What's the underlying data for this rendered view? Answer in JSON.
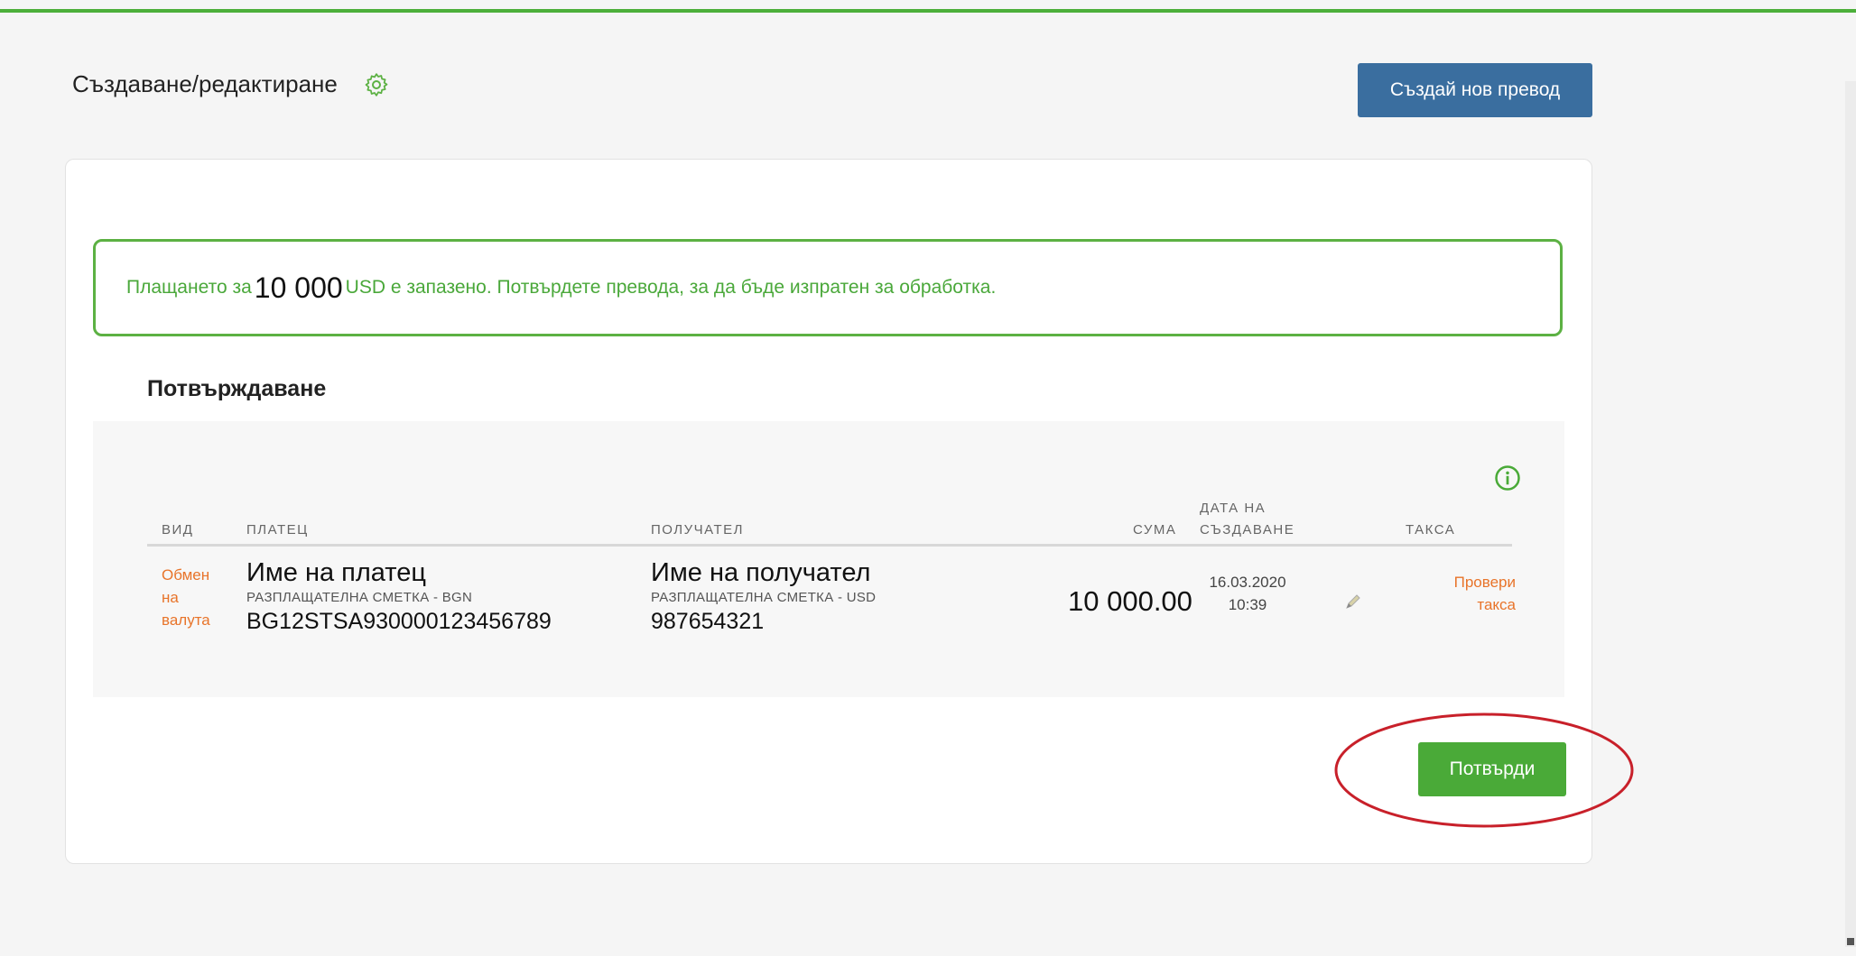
{
  "header": {
    "title": "Създаване/редактиране",
    "settings_icon": "gear-icon",
    "new_transfer_button": "Създай нов превод"
  },
  "alert": {
    "prefix": "Плащането за",
    "amount": "10 000",
    "suffix": "USD е запазено. Потвърдете превода, за да бъде изпратен за обработка."
  },
  "confirmation": {
    "title": "Потвърждаване",
    "info_icon": "info-icon",
    "columns": {
      "type": "вид",
      "payer": "платец",
      "recipient": "получател",
      "sum": "сума",
      "date_line1": "дата на",
      "date_line2": "създаване",
      "fee": "такса"
    },
    "row": {
      "type_line1": "Обмен",
      "type_line2": "на",
      "type_line3": "валута",
      "payer_name": "Име на платец",
      "payer_account_type": "РАЗПЛАЩАТЕЛНА СМЕТКА - BGN",
      "payer_account": "BG12STSA930000123456789",
      "recipient_name": "Име на получател",
      "recipient_account_type": "РАЗПЛАЩАТЕЛНА СМЕТКА - USD",
      "recipient_account": "987654321",
      "sum": "10 000.00",
      "date": "16.03.2020",
      "time": "10:39",
      "edit_icon": "pencil-icon",
      "fee_line1": "Провери",
      "fee_line2": "такса"
    },
    "confirm_button": "Потвърди"
  },
  "colors": {
    "accent_green": "#4aaa38",
    "primary_blue": "#3a6e9f",
    "orange_link": "#e8742a",
    "annotation_red": "#c8202a"
  }
}
